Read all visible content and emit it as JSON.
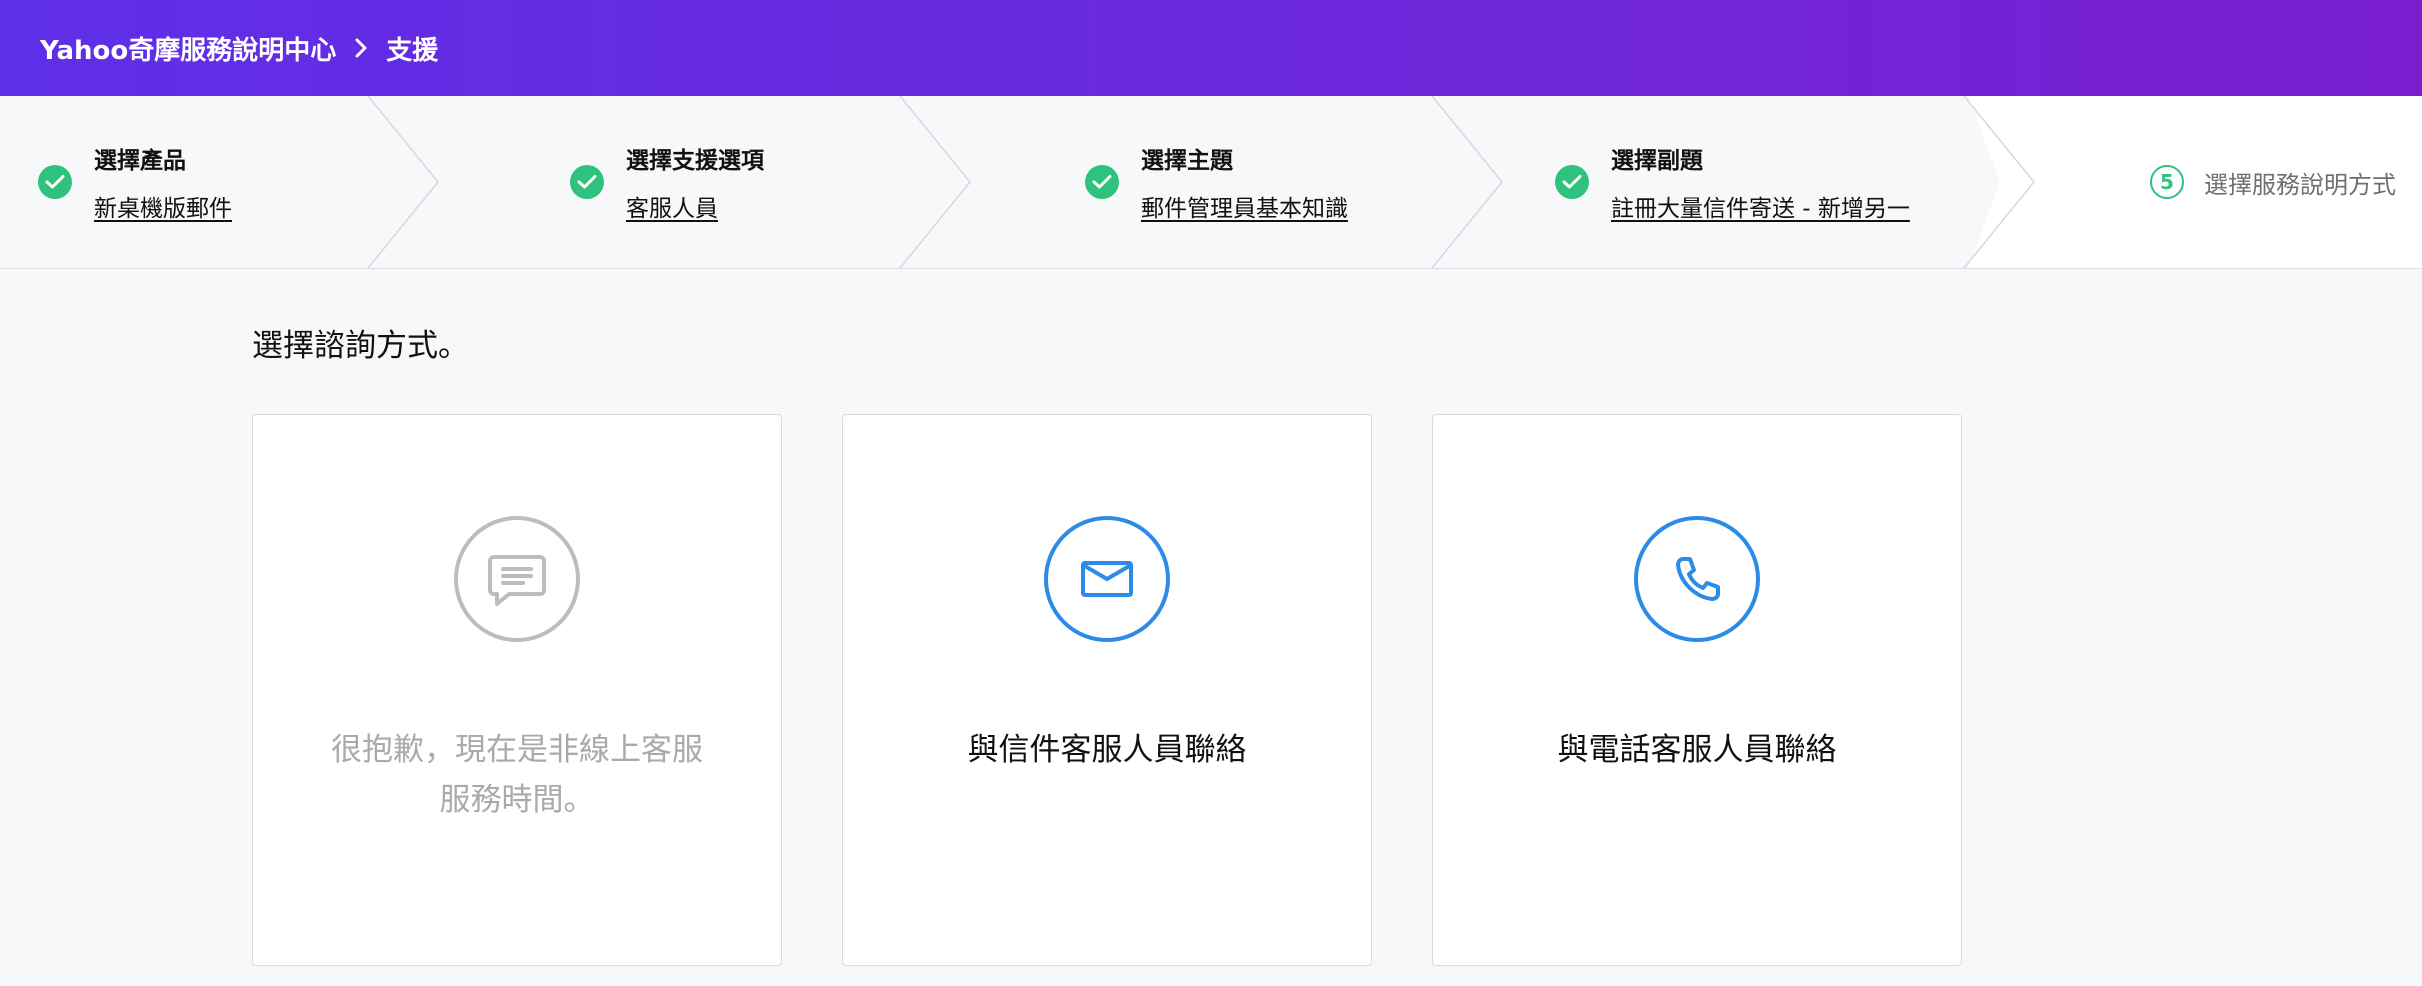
{
  "header": {
    "brand": "Yahoo奇摩服務說明中心",
    "current": "支援"
  },
  "steps": [
    {
      "title": "選擇產品",
      "value": "新桌機版郵件",
      "status": "done"
    },
    {
      "title": "選擇支援選項",
      "value": "客服人員",
      "status": "done"
    },
    {
      "title": "選擇主題",
      "value": "郵件管理員基本知識",
      "status": "done"
    },
    {
      "title": "選擇副題",
      "value": "註冊大量信件寄送 - 新增另一",
      "status": "done"
    },
    {
      "number": "5",
      "title": "選擇服務說明方式",
      "status": "current"
    }
  ],
  "main": {
    "title": "選擇諮詢方式。",
    "cards": [
      {
        "label": "很抱歉，現在是非線上客服服務時間。",
        "icon": "chat-bubble-icon",
        "enabled": false
      },
      {
        "label": "與信件客服人員聯絡",
        "icon": "envelope-icon",
        "enabled": true
      },
      {
        "label": "與電話客服人員聯絡",
        "icon": "phone-icon",
        "enabled": true
      }
    ]
  },
  "colors": {
    "header_start": "#5f2ee8",
    "header_end": "#7a1fd0",
    "success": "#2ec27e",
    "accent": "#2b8be6",
    "disabled": "#bdbdbd"
  }
}
